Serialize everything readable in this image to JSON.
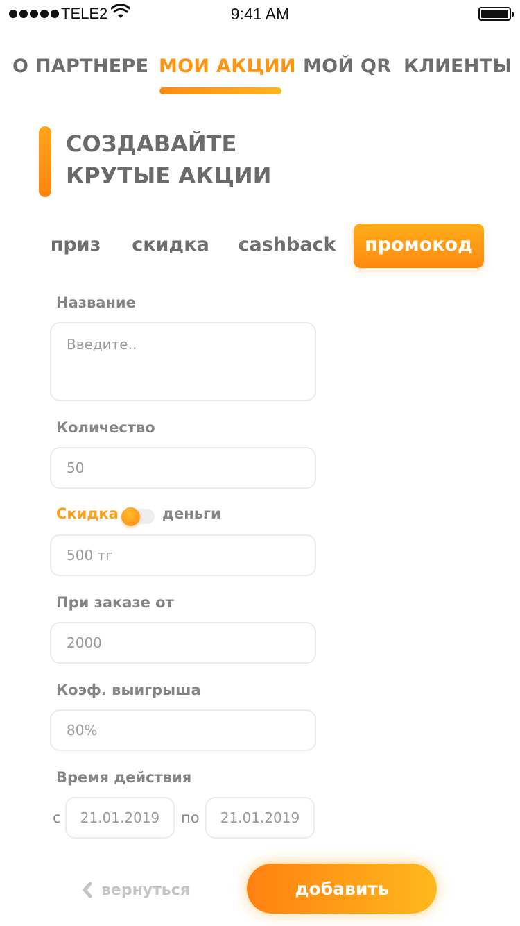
{
  "status_bar": {
    "carrier": "TELE2",
    "time": "9:41 AM"
  },
  "nav": {
    "items": [
      {
        "label": "О ПАРТНЕРЕ"
      },
      {
        "label": "МОИ АКЦИИ"
      },
      {
        "label": "МОЙ QR"
      },
      {
        "label": "КЛИЕНТЫ"
      }
    ],
    "active_index": 1
  },
  "heading": {
    "line1": "СОЗДАВАЙТЕ",
    "line2": "КРУТЫЕ АКЦИИ"
  },
  "promo_types": {
    "items": [
      {
        "label": "приз"
      },
      {
        "label": "скидка"
      },
      {
        "label": "cashback"
      },
      {
        "label": "промокод"
      }
    ],
    "active_index": 3
  },
  "form": {
    "name": {
      "label": "Название",
      "placeholder": "Введите..",
      "value": ""
    },
    "quantity": {
      "label": "Количество",
      "placeholder": "50"
    },
    "discount_toggle": {
      "left_label": "Скидка",
      "right_label": "деньги",
      "state": "Скидка"
    },
    "discount_value": {
      "placeholder": "500 тг"
    },
    "min_order": {
      "label": "При заказе от",
      "placeholder": "2000"
    },
    "win_coef": {
      "label": "Коэф. выигрыша",
      "placeholder": "80%"
    },
    "period": {
      "label": "Время действия",
      "from_prefix": "с",
      "from_placeholder": "21.01.2019",
      "to_prefix": "по",
      "to_placeholder": "21.01.2019"
    }
  },
  "actions": {
    "back_label": "вернуться",
    "back_icon": "chevron-left-icon",
    "submit_label": "добавить"
  },
  "colors": {
    "accent": "#ff9410",
    "accent_light": "#ffb61c",
    "text_muted": "#6e6e6e",
    "field_border": "#ececec"
  }
}
